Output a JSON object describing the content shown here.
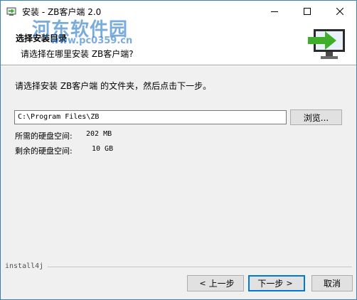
{
  "window": {
    "title": "安装 - ZB客户端 2.0",
    "controls": {
      "minimize": "minimize",
      "maximize": "maximize",
      "close": "close"
    }
  },
  "header": {
    "title": "选择安装目录",
    "subtitle": "请选择在哪里安装 ZB客户端?",
    "watermark_name": "河东软件园",
    "watermark_url": "www.pc0359.cn"
  },
  "body": {
    "instruction": "请选择安装 ZB客户端 的文件夹，然后点击下一步。",
    "path_value": "C:\\Program Files\\ZB",
    "browse_label": "浏览...",
    "required_label": "所需的硬盘空间:",
    "required_value": "202 MB",
    "free_label": "剩余的硬盘空间:",
    "free_value": "10 GB"
  },
  "footer": {
    "brand": "install4j",
    "back_glyph": "<",
    "back_label": "上一步",
    "next_label": "下一步",
    "next_glyph": ">",
    "cancel_label": "取消"
  },
  "colors": {
    "accent": "#0078d7",
    "window_border": "#3c7fb1",
    "arrow_green": "#3fae2a",
    "watermark_blue": "#2878c8"
  }
}
